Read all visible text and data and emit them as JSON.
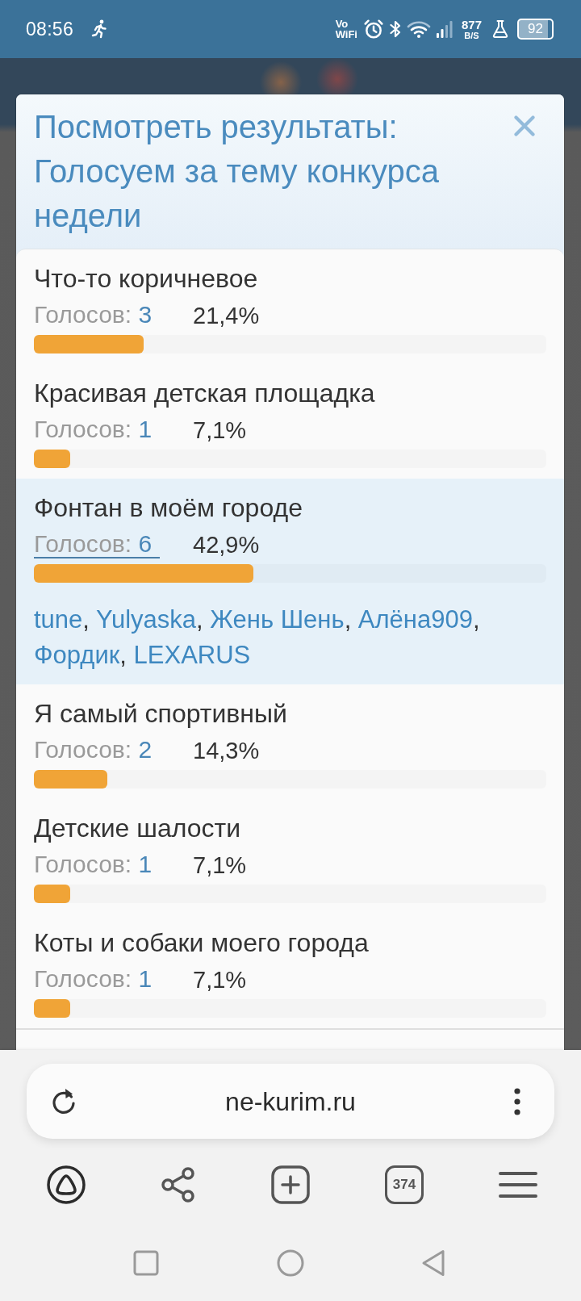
{
  "status_bar": {
    "time": "08:56",
    "vowifi": "Vo WiFi",
    "net_speed": "877",
    "net_speed_unit": "B/S",
    "battery": "92"
  },
  "dialog": {
    "title": "Посмотреть результаты: Голосуем за тему конкурса недели",
    "options": [
      {
        "label": "Что-то коричневое",
        "votes_label": "Голосов:",
        "votes": "3",
        "percent": "21,4%",
        "level": 0.214,
        "expanded": false
      },
      {
        "label": "Красивая детская площадка",
        "votes_label": "Голосов:",
        "votes": "1",
        "percent": "7,1%",
        "level": 0.071,
        "expanded": false
      },
      {
        "label": "Фонтан в моём городе",
        "votes_label": "Голосов:",
        "votes": "6",
        "percent": "42,9%",
        "level": 0.429,
        "expanded": true,
        "separator": ",",
        "voters": [
          "tune",
          "Yulyaska",
          "Жень Шень",
          "Алёна909",
          "Фордик",
          "LEXARUS"
        ]
      },
      {
        "label": "Я самый спортивный",
        "votes_label": "Голосов:",
        "votes": "2",
        "percent": "14,3%",
        "level": 0.143,
        "expanded": false
      },
      {
        "label": "Детские шалости",
        "votes_label": "Голосов:",
        "votes": "1",
        "percent": "7,1%",
        "level": 0.071,
        "expanded": false
      },
      {
        "label": "Коты и собаки моего города",
        "votes_label": "Голосов:",
        "votes": "1",
        "percent": "7,1%",
        "level": 0.071,
        "expanded": false
      }
    ]
  },
  "browser": {
    "url": "ne-kurim.ru",
    "tab_count": "374"
  }
}
